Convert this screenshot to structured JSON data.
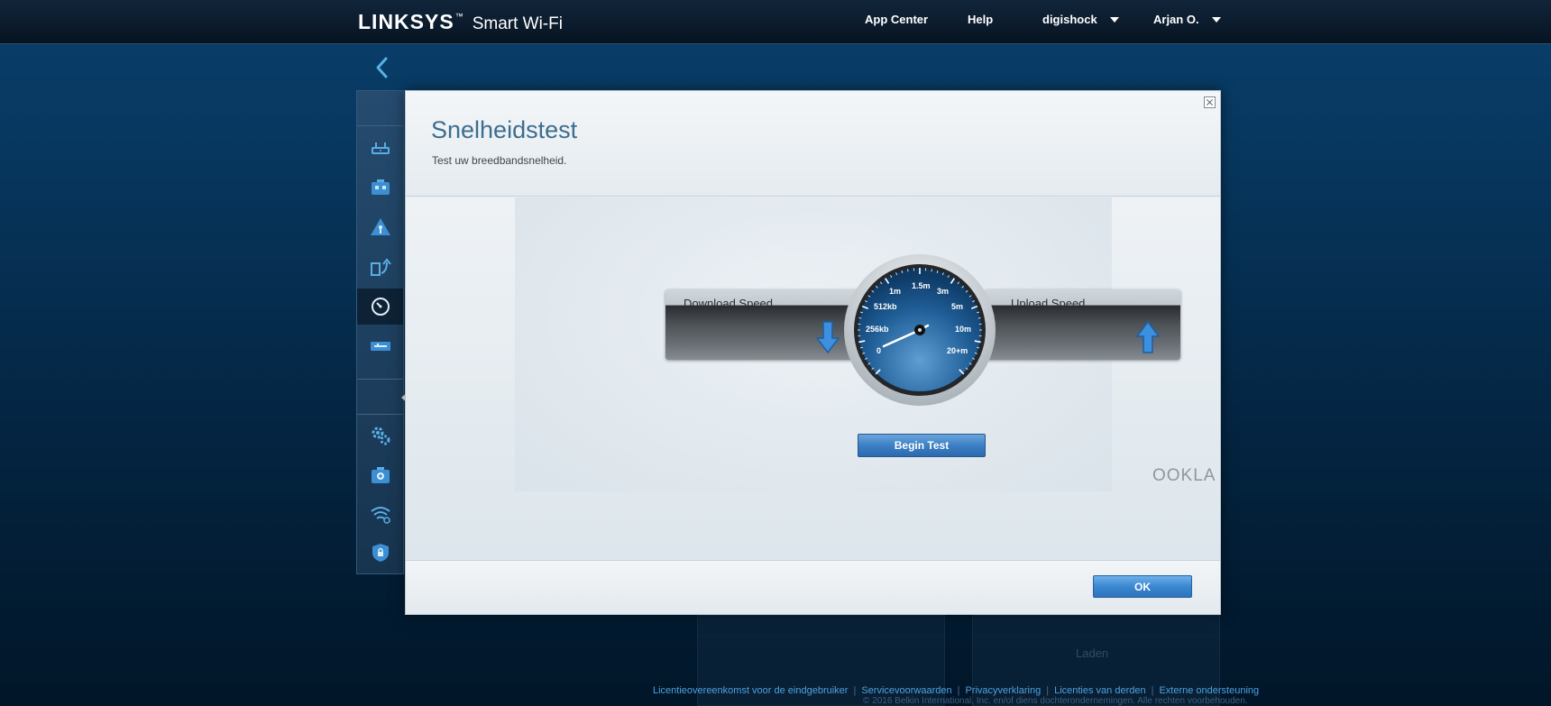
{
  "header": {
    "brand": "LINKSYS",
    "brand_mark": "™",
    "product": "Smart Wi-Fi",
    "nav": {
      "app_center": "App Center",
      "help": "Help",
      "router_name": "digishock",
      "user_name": "Arjan O."
    }
  },
  "sidebar": {
    "items": [
      {
        "icon": "router-icon"
      },
      {
        "icon": "devices-icon"
      },
      {
        "icon": "parental-controls-icon"
      },
      {
        "icon": "media-prioritization-icon"
      },
      {
        "icon": "speed-test-icon",
        "active": true
      },
      {
        "icon": "external-storage-icon"
      },
      {
        "icon": "connectivity-gears-icon"
      },
      {
        "icon": "troubleshooting-icon"
      },
      {
        "icon": "wireless-settings-icon"
      },
      {
        "icon": "security-shield-icon"
      }
    ]
  },
  "modal": {
    "title": "Snelheidstest",
    "subtitle": "Test uw breedbandsnelheid.",
    "download_label": "Download Speed",
    "upload_label": "Upload Speed",
    "gauge_labels": [
      "0",
      "256kb",
      "512kb",
      "1m",
      "1.5m",
      "3m",
      "5m",
      "10m",
      "20+m"
    ],
    "begin_button": "Begin Test",
    "powered_by": "OOKLA",
    "ok_button": "OK"
  },
  "background": {
    "loading_text": "Laden"
  },
  "footer": {
    "links": [
      "Licentieovereenkomst voor de eindgebruiker",
      "Servicevoorwaarden",
      "Privacyverklaring",
      "Licenties van derden",
      "Externe ondersteuning"
    ],
    "copyright": "© 2016 Belkin International, Inc. en/of diens dochterondernemingen. Alle rechten voorbehouden."
  },
  "colors": {
    "accent": "#3b87d1",
    "title": "#3d6d8f",
    "link": "#4da1df"
  }
}
